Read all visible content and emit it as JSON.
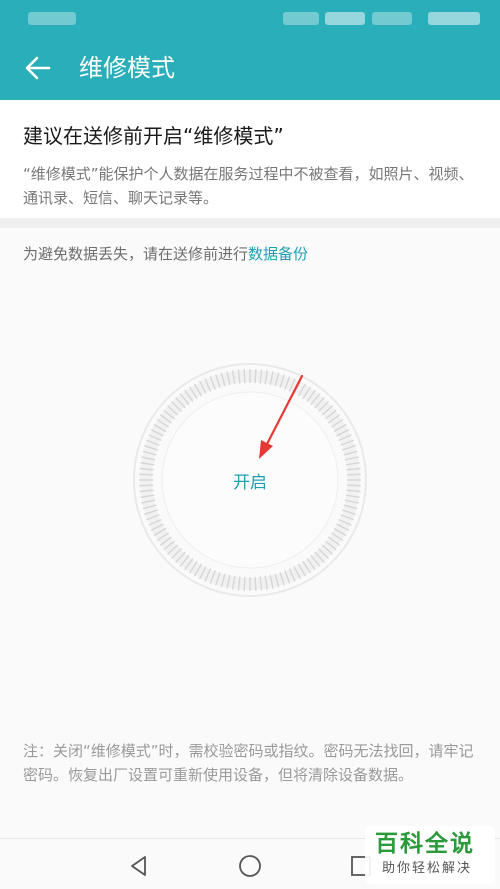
{
  "header": {
    "title": "维修模式",
    "back_icon": "arrow-left-icon",
    "background": "#2aaeb9"
  },
  "intro": {
    "title": "建议在送修前开启“维修模式”",
    "description": "“维修模式”能保护个人数据在服务过程中不被查看，如照片、视频、通讯录、短信、聊天记录等。"
  },
  "backup": {
    "prefix": "为避免数据丢失，请在送修前进行",
    "link_label": "数据备份",
    "link_color": "#1e9fb0"
  },
  "dial": {
    "button_label": "开启",
    "accent": "#1e9fb0"
  },
  "annotation": {
    "arrow_color": "#e53935"
  },
  "footnote": {
    "text": "注：关闭“维修模式”时，需校验密码或指纹。密码无法找回，请牢记密码。恢复出厂设置可重新使用设备，但将清除设备数据。"
  },
  "navbar": {
    "back_icon": "triangle-back-icon",
    "home_icon": "circle-home-icon",
    "recent_icon": "square-recent-icon"
  },
  "watermark": {
    "brand": "百科全说",
    "slogan": "助你轻松解决"
  }
}
